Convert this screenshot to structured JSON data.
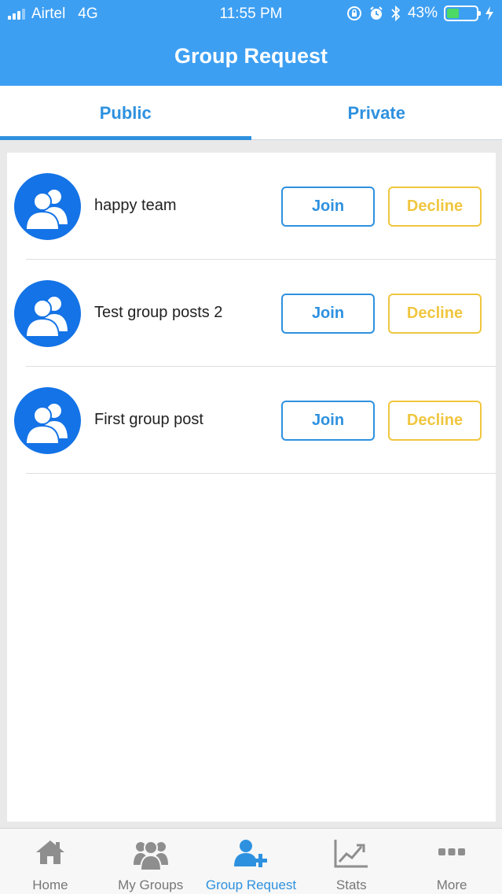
{
  "status_bar": {
    "carrier": "Airtel",
    "network": "4G",
    "time": "11:55 PM",
    "battery_percent": "43%",
    "battery_level": 0.43
  },
  "header": {
    "title": "Group Request"
  },
  "tabs": [
    {
      "label": "Public",
      "active": true
    },
    {
      "label": "Private",
      "active": false
    }
  ],
  "requests": [
    {
      "name": "happy team",
      "join_label": "Join",
      "decline_label": "Decline"
    },
    {
      "name": "Test group posts 2",
      "join_label": "Join",
      "decline_label": "Decline"
    },
    {
      "name": "First group post",
      "join_label": "Join",
      "decline_label": "Decline"
    }
  ],
  "tab_bar": [
    {
      "label": "Home",
      "icon": "home-icon"
    },
    {
      "label": "My Groups",
      "icon": "groups-icon"
    },
    {
      "label": "Group Request",
      "icon": "add-user-icon",
      "active": true
    },
    {
      "label": "Stats",
      "icon": "chart-icon"
    },
    {
      "label": "More",
      "icon": "more-icon"
    }
  ],
  "colors": {
    "primary": "#3d9ff2",
    "accent_blue": "#2e91df",
    "avatar_blue": "#1473e6",
    "decline_yellow": "#f0c63f",
    "battery_green": "#4cd964"
  }
}
